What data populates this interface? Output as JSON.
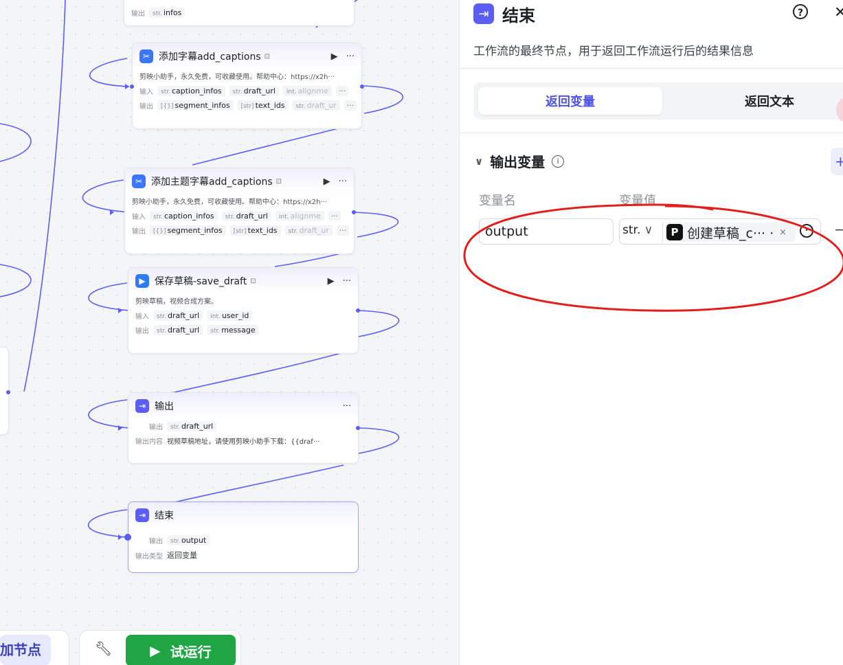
{
  "canvas": {
    "info_node": {
      "out_label": "输出",
      "out_chip": {
        "type": "str.",
        "name": "infos"
      }
    },
    "add_captions": {
      "title": "添加字幕add_captions",
      "desc": "剪映小助手，永久免费，可收藏使用。帮助中心：https://x2h···",
      "in_label": "输入",
      "inputs": [
        {
          "type": "str.",
          "name": "caption_infos"
        },
        {
          "type": "str.",
          "name": "draft_url"
        },
        {
          "type": "int.",
          "name": "alignme"
        }
      ],
      "out_label": "输出",
      "outputs": [
        {
          "type": "[{}]",
          "name": "segment_infos"
        },
        {
          "type": "[str]",
          "name": "text_ids"
        },
        {
          "type": "str.",
          "name": "draft_ur"
        }
      ]
    },
    "add_theme_captions": {
      "title": "添加主题字幕add_captions",
      "desc": "剪映小助手，永久免费，可收藏使用。帮助中心：https://x2h···",
      "in_label": "输入",
      "inputs": [
        {
          "type": "str.",
          "name": "caption_infos"
        },
        {
          "type": "str.",
          "name": "draft_url"
        },
        {
          "type": "int.",
          "name": "alignme"
        }
      ],
      "out_label": "输出",
      "outputs": [
        {
          "type": "[{}]",
          "name": "segment_infos"
        },
        {
          "type": "[str]",
          "name": "text_ids"
        },
        {
          "type": "str.",
          "name": "draft_ur"
        }
      ]
    },
    "save_draft": {
      "title": "保存草稿-save_draft",
      "desc": "剪映草稿，视频合成方案。",
      "in_label": "输入",
      "inputs": [
        {
          "type": "str.",
          "name": "draft_url"
        },
        {
          "type": "int.",
          "name": "user_id"
        }
      ],
      "out_label": "输出",
      "outputs": [
        {
          "type": "str.",
          "name": "draft_url"
        },
        {
          "type": "str.",
          "name": "message"
        }
      ]
    },
    "output_node": {
      "title": "输出",
      "out_label": "输出",
      "output": {
        "type": "str.",
        "name": "draft_url"
      },
      "content_label": "输出内容",
      "content": "视频草稿地址，请使用剪映小助手下载：{{draf···"
    },
    "end_node": {
      "title": "结束",
      "out_label": "输出",
      "output": {
        "type": "str.",
        "name": "output"
      },
      "type_label": "输出类型",
      "type_value": "返回变量"
    },
    "add_node_button": "加节点",
    "test_run_button": "试运行"
  },
  "panel": {
    "title": "结束",
    "description": "工作流的最终节点，用于返回工作流运行后的结果信息",
    "tabs": [
      "返回变量",
      "返回文本"
    ],
    "active_tab": "返回变量",
    "section_title": "输出变量",
    "col_name": "变量名",
    "col_value": "变量值",
    "var_name": "output",
    "var_type": "str.",
    "var_ref": "创建草稿_c··· ·",
    "annotation_color": "#e0201d",
    "accent": "#4d53e8"
  }
}
